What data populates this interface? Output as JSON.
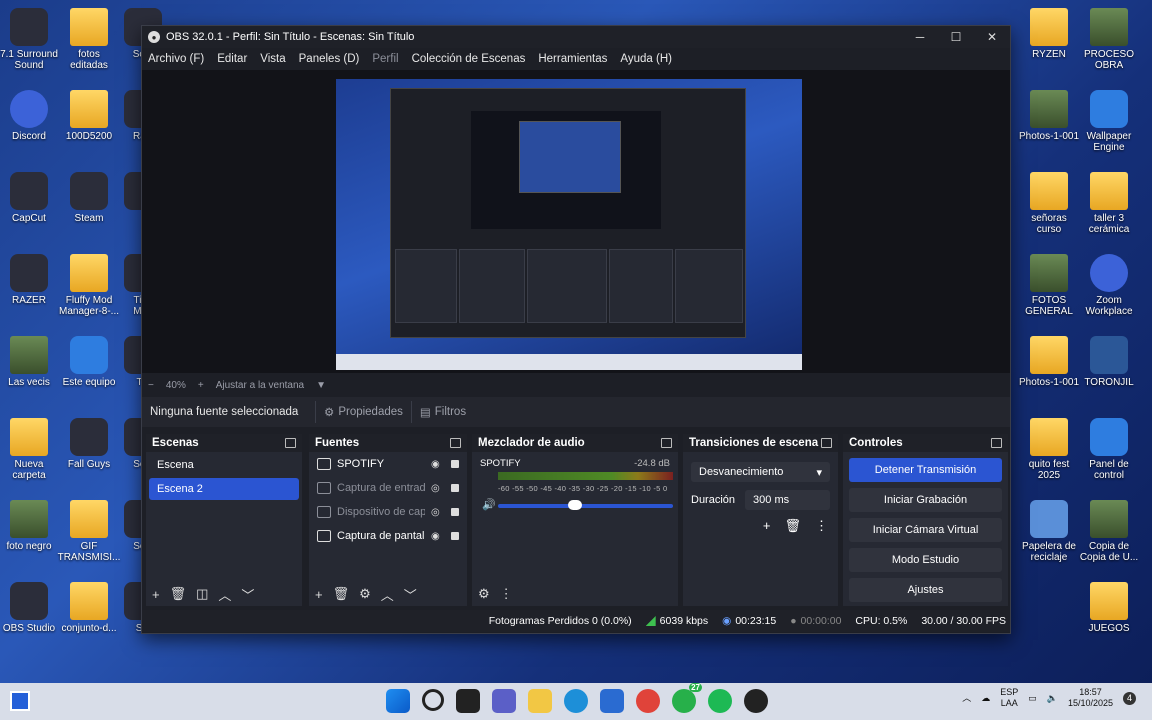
{
  "desktop": {
    "left": [
      {
        "label": "7.1 Surround\nSound",
        "kind": "app"
      },
      {
        "label": "Discord",
        "kind": "blue"
      },
      {
        "label": "CapCut",
        "kind": "app"
      },
      {
        "label": "RAZER",
        "kind": "app"
      },
      {
        "label": "Las vecis",
        "kind": "pic"
      },
      {
        "label": "Nueva\ncarpeta",
        "kind": "folder"
      },
      {
        "label": "foto negro",
        "kind": "pic"
      },
      {
        "label": "OBS Studio",
        "kind": "app"
      }
    ],
    "left2": [
      {
        "label": "fotos\neditadas",
        "kind": "folder"
      },
      {
        "label": "100D5200",
        "kind": "folder"
      },
      {
        "label": "Steam",
        "kind": "app"
      },
      {
        "label": "Fluffy Mod\nManager-8-...",
        "kind": "folder"
      },
      {
        "label": "Este equipo",
        "kind": "cyan"
      },
      {
        "label": "Fall Guys",
        "kind": "app"
      },
      {
        "label": "GIF\nTRANSMISI...",
        "kind": "folder"
      },
      {
        "label": "conjunto-d...",
        "kind": "folder"
      }
    ],
    "left3": [
      "Scre",
      "Razi",
      "",
      "TikT\nMan",
      "Tik",
      "Soci",
      "Soci",
      "Sin"
    ],
    "right1": [
      {
        "label": "RYZEN",
        "kind": "folder"
      },
      {
        "label": "Photos-1-001",
        "kind": "pic"
      },
      {
        "label": "señoras\ncurso",
        "kind": "folder"
      },
      {
        "label": "FOTOS\nGENERAL",
        "kind": "pic"
      },
      {
        "label": "Photos-1-001",
        "kind": "folder"
      },
      {
        "label": "quito fest\n2025",
        "kind": "folder"
      },
      {
        "label": "Papelera de\nreciclaje",
        "kind": "bin"
      }
    ],
    "right2": [
      {
        "label": "PROCESO\nOBRA",
        "kind": "pic"
      },
      {
        "label": "Wallpaper\nEngine",
        "kind": "cyan"
      },
      {
        "label": "taller 3\ncerámica",
        "kind": "folder"
      },
      {
        "label": "Zoom\nWorkplace",
        "kind": "blue"
      },
      {
        "label": "TORONJIL",
        "kind": "word"
      },
      {
        "label": "Panel de\ncontrol",
        "kind": "cyan"
      },
      {
        "label": "Copia de\nCopia de U...",
        "kind": "pic"
      },
      {
        "label": "JUEGOS",
        "kind": "folder"
      }
    ]
  },
  "window": {
    "title": "OBS 32.0.1 - Perfil: Sin Título - Escenas: Sin Título",
    "controls": [
      "─",
      "☐",
      "✕"
    ]
  },
  "menu": [
    "Archivo (F)",
    "Editar",
    "Vista",
    "Paneles (D)",
    "Perfil",
    "Colección de Escenas",
    "Herramientas",
    "Ayuda (H)"
  ],
  "zoom": {
    "minus": "−",
    "value": "40%",
    "plus": "+",
    "fit": "Ajustar a la ventana"
  },
  "source_bar": {
    "none_selected": "Ninguna fuente seleccionada",
    "properties": "Propiedades",
    "filters": "Filtros"
  },
  "scenes": {
    "title": "Escenas",
    "items": [
      "Escena",
      "Escena 2"
    ],
    "selected": 1
  },
  "sources": {
    "title": "Fuentes",
    "items": [
      {
        "label": "SPOTIFY",
        "visible": true
      },
      {
        "label": "Captura de entrada de audio",
        "visible": false
      },
      {
        "label": "Dispositivo de captura",
        "visible": false
      },
      {
        "label": "Captura de pantalla",
        "visible": true
      }
    ]
  },
  "mixer": {
    "title": "Mezclador de audio",
    "channel": "SPOTIFY",
    "db": "-24.8 dB",
    "ticks": "-60 -55 -50 -45 -40 -35 -30 -25 -20 -15 -10 -5 0",
    "volume_fraction": 0.44
  },
  "transitions": {
    "title": "Transiciones de escena",
    "type": "Desvanecimiento",
    "duration_label": "Duración",
    "duration": "300 ms"
  },
  "controls": {
    "title": "Controles",
    "buttons": [
      "Detener Transmisión",
      "Iniciar Grabación",
      "Iniciar Cámara Virtual",
      "Modo Estudio",
      "Ajustes"
    ]
  },
  "status": {
    "dropped": "Fotogramas Perdidos 0 (0.0%)",
    "bitrate": "6039 kbps",
    "stream_time": "00:23:15",
    "rec_time": "00:00:00",
    "cpu": "CPU: 0.5%",
    "fps": "30.00 / 30.00 FPS"
  },
  "taskbar": {
    "lang": "ESP\nLAA",
    "time": "18:57",
    "date": "15/10/2025",
    "notif": "4",
    "badge": "27"
  }
}
